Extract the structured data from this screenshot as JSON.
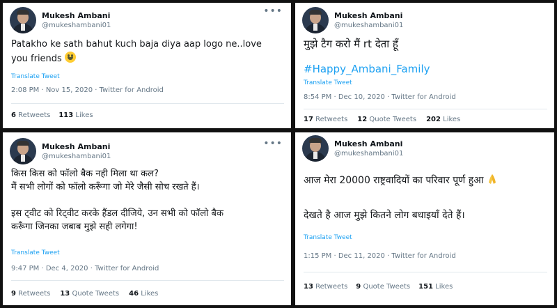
{
  "tweets": [
    {
      "name": "Mukesh Ambani",
      "handle": "@mukeshambani01",
      "lines": [
        "Patakho ke sath bahut kuch baja diya aap logo ne..love",
        "you friends"
      ],
      "translate": "Translate Tweet",
      "meta": "2:08 PM · Nov 15, 2020 · Twitter for Android",
      "retweets": "6",
      "retweets_label": "Retweets",
      "likes": "113",
      "likes_label": "Likes"
    },
    {
      "name": "Mukesh Ambani",
      "handle": "@mukeshambani01",
      "line1": "मुझे टैग करो मैं rt देता हूँ",
      "hashtag": "#Happy_Ambani_Family",
      "translate": "Translate Tweet",
      "meta": "8:54 PM · Dec 10, 2020 · Twitter for Android",
      "retweets": "17",
      "retweets_label": "Retweets",
      "quotes": "12",
      "quotes_label": "Quote Tweets",
      "likes": "202",
      "likes_label": "Likes"
    },
    {
      "name": "Mukesh Ambani",
      "handle": "@mukeshambani01",
      "lines": [
        "किस किस को फॉलो बैक नही मिला था कल?",
        "मैं सभी लोगों को फॉलो करूँगा जो मेरे जैसी सोच रखते हैं।",
        "",
        "इस ट्वीट को रिट्वीट करके हैंडल दीजिये, उन सभी को फॉलो बैक",
        "करूँगा जिनका जबाब मुझे सही लगेगा!"
      ],
      "translate": "Translate Tweet",
      "meta": "9:47 PM · Dec 4, 2020 · Twitter for Android",
      "retweets": "9",
      "retweets_label": "Retweets",
      "quotes": "13",
      "quotes_label": "Quote Tweets",
      "likes": "46",
      "likes_label": "Likes"
    },
    {
      "name": "Mukesh Ambani",
      "handle": "@mukeshambani01",
      "line1": "आज मेरा 20000 राष्ट्रवादियों का परिवार पूर्ण हुआ",
      "line2": "देखते है आज मुझे कितने लोग बधाइयाँ देते हैं।",
      "translate": "Translate Tweet",
      "meta": "1:15 PM · Dec 11, 2020 · Twitter for Android",
      "retweets": "13",
      "retweets_label": "Retweets",
      "quotes": "9",
      "quotes_label": "Quote Tweets",
      "likes": "151",
      "likes_label": "Likes"
    }
  ],
  "icons": {
    "avatar": "profile-photo",
    "more": "more-dots-icon",
    "emoji1": "grinning-face-emoji",
    "emoji2": "folded-hands-emoji"
  }
}
